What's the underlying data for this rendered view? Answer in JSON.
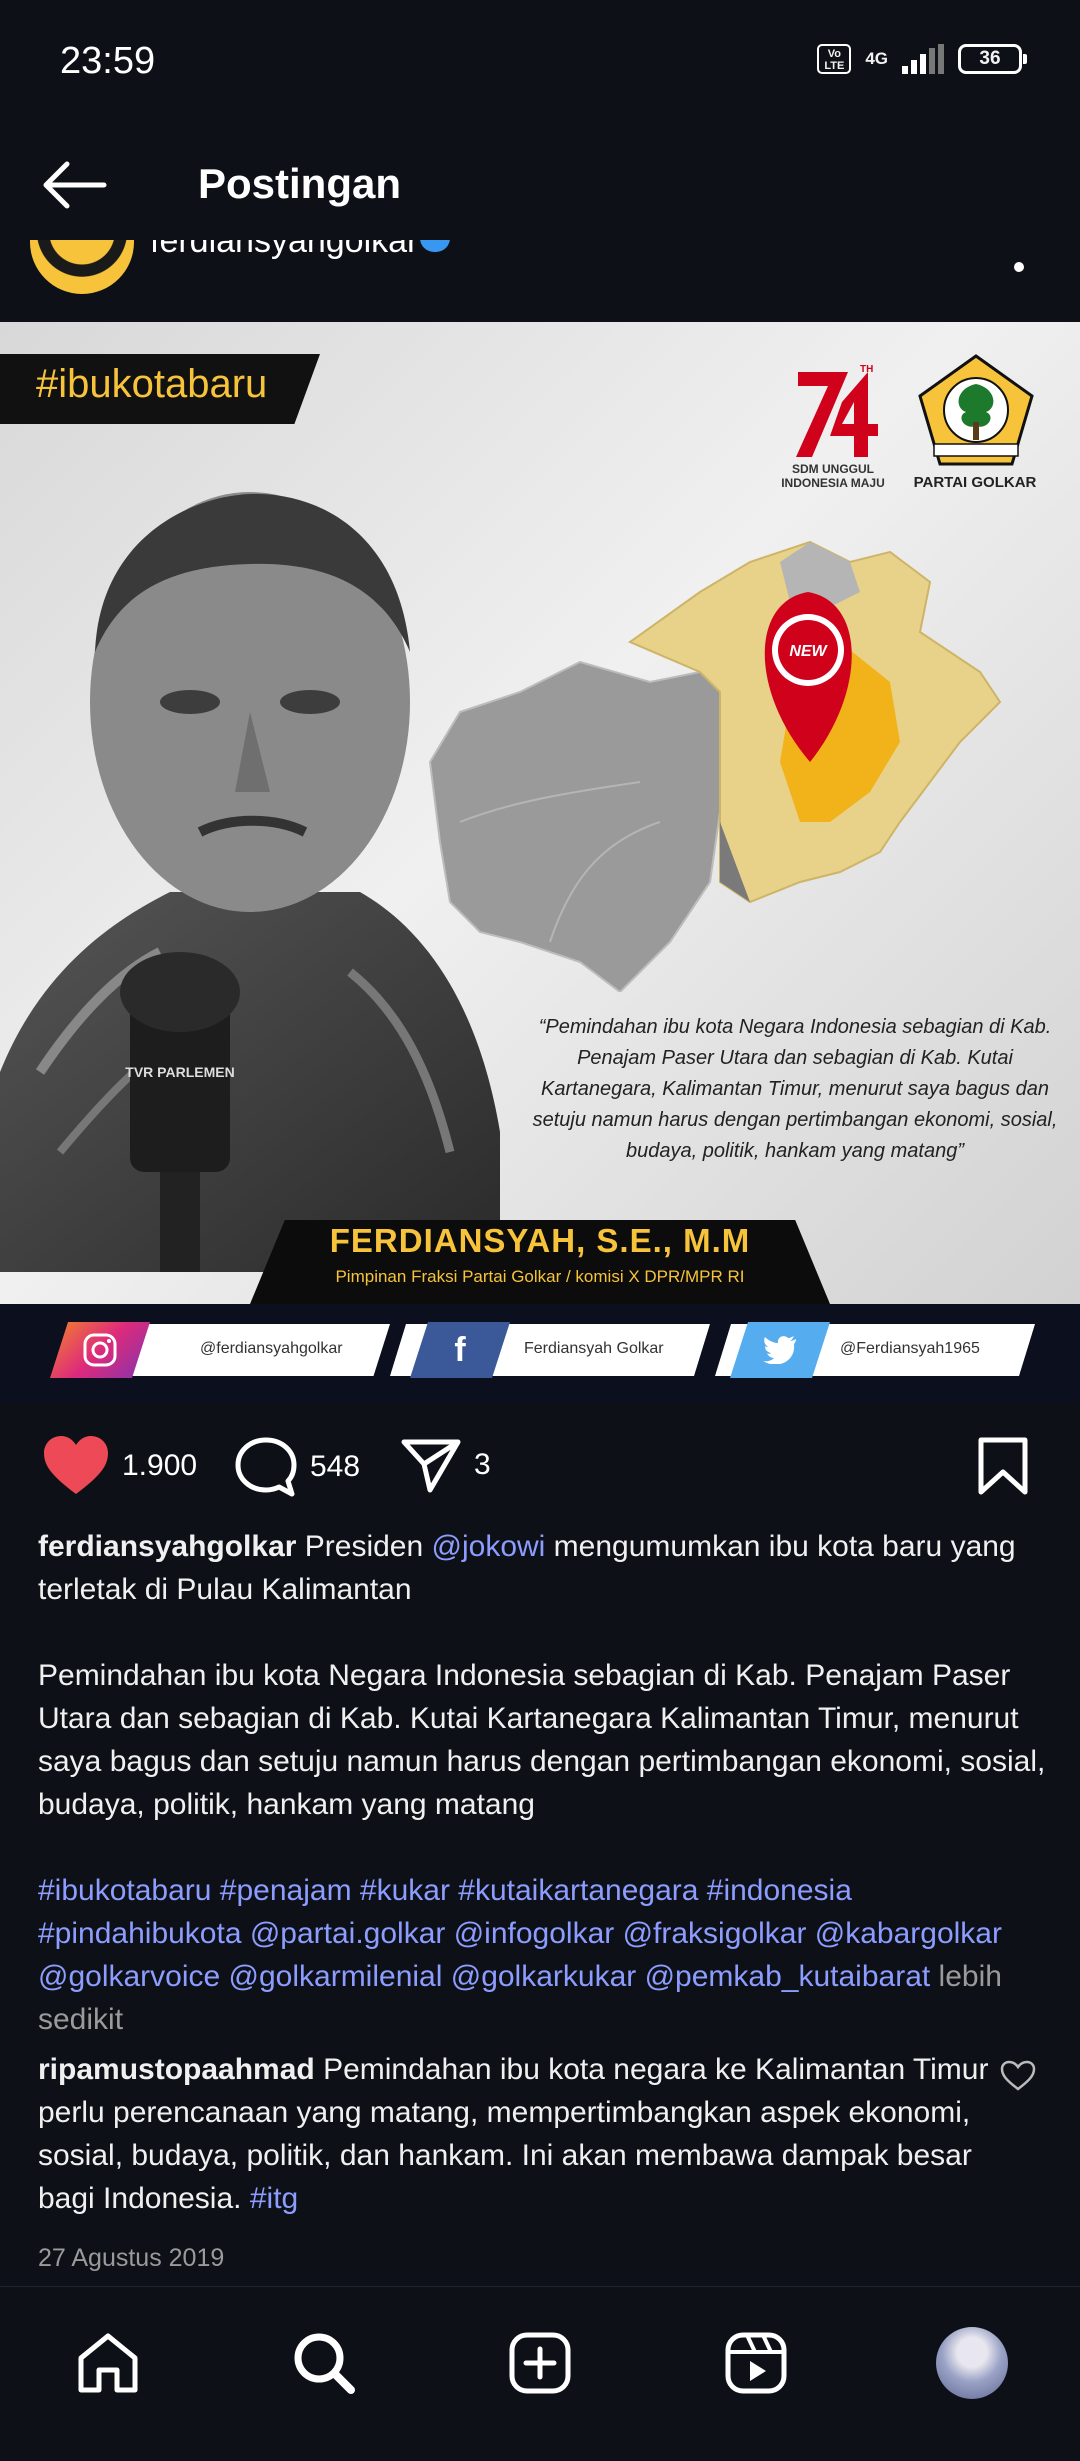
{
  "status_bar": {
    "time": "23:59",
    "volte": "Vo LTE",
    "network": "4G",
    "battery": "36"
  },
  "header": {
    "title": "Postingan"
  },
  "post": {
    "username": "ferdiansyahgolkar",
    "image": {
      "hashtag": "#ibukotabaru",
      "anniversary_text": "SDM UNGGUL INDONESIA MAJU",
      "party_badge": "GOLONGAN KARYA",
      "party_name": "PARTAI GOLKAR",
      "pin_label": "NEW",
      "mic_label": "TVR PARLEMEN",
      "quote": "“Pemindahan ibu kota Negara Indonesia sebagian di Kab. Penajam Paser Utara dan sebagian di Kab. Kutai Kartanegara, Kalimantan Timur, menurut saya bagus dan setuju namun harus dengan pertimbangan ekonomi, sosial,  budaya, politik, hankam yang matang”",
      "person_name": "FERDIANSYAH, S.E., M.M",
      "person_role": "Pimpinan Fraksi Partai Golkar / komisi X DPR/MPR RI",
      "social": {
        "instagram": "@ferdiansyahgolkar",
        "facebook": "Ferdiansyah Golkar",
        "twitter": "@Ferdiansyah1965"
      }
    },
    "likes": "1.900",
    "comments_count": "548",
    "shares": "3",
    "caption": {
      "username": "ferdiansyahgolkar",
      "text_part1": " Presiden ",
      "mention": "@jokowi",
      "text_part2": " mengumumkan ibu kota baru yang terletak di Pulau Kalimantan",
      "paragraph2": "Pemindahan ibu kota Negara Indonesia sebagian di Kab. Penajam Paser Utara dan sebagian di Kab. Kutai Kartanegara Kalimantan Timur, menurut saya bagus dan setuju namun harus dengan pertimbangan ekonomi, sosial,  budaya, politik, hankam yang matang",
      "tags": "#ibukotabaru #penajam #kukar #kutaikartanegara #indonesia #pindahibukota @partai.golkar @infogolkar @fraksigolkar @kabargolkar @golkarvoice @golkarmilenial @golkarkukar @pemkab_kutaibarat",
      "less": " lebih sedikit"
    },
    "comment": {
      "username": "ripamustopaahmad",
      "text": " Pemindahan ibu kota negara ke Kalimantan Timur perlu perencanaan yang matang, mempertimbangkan aspek ekonomi, sosial, budaya, politik, dan hankam. Ini akan membawa dampak besar bagi Indonesia. ",
      "tag": "#itg"
    },
    "date": "27 Agustus 2019"
  },
  "nav": [
    "home-icon",
    "search-icon",
    "create-icon",
    "reels-icon",
    "profile-avatar"
  ],
  "colors": {
    "background": "#0d1117",
    "like_red": "#ed4956",
    "link": "#8c9cff",
    "golkar_yellow": "#f6c33b"
  }
}
